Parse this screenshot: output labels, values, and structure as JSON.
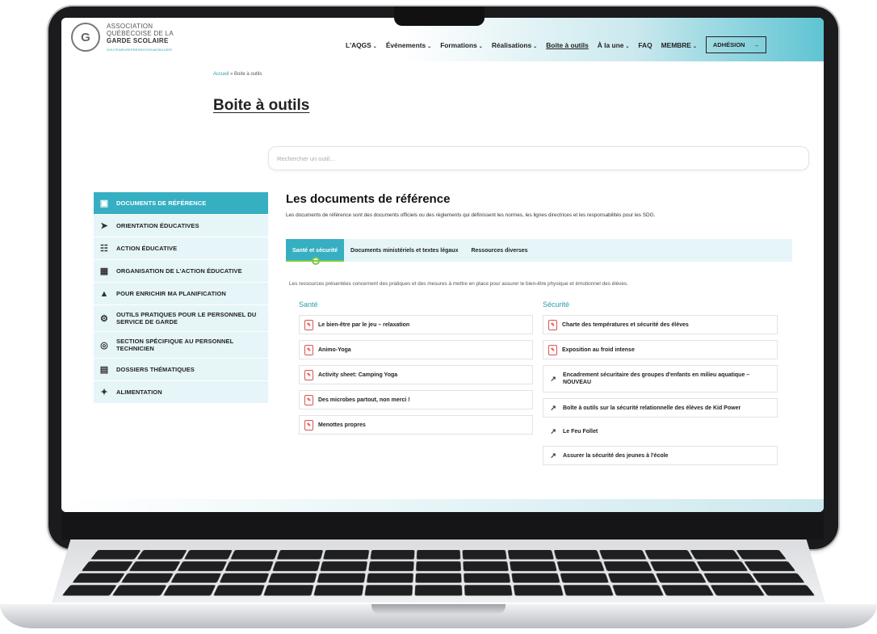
{
  "logo": {
    "line1": "ASSOCIATION",
    "line2": "QUÉBÉCOISE DE LA",
    "line3": "GARDE SCOLAIRE",
    "tagline": "SOUTENIR•REPRÉSENTER•MOBILISER"
  },
  "nav": {
    "items": [
      {
        "label": "L'AQGS",
        "caret": "⌄"
      },
      {
        "label": "Événements",
        "caret": "⌄"
      },
      {
        "label": "Formations",
        "caret": "⌄"
      },
      {
        "label": "Réalisations",
        "caret": "⌄"
      },
      {
        "label": "Boite à outils",
        "caret": ""
      },
      {
        "label": "À la une",
        "caret": "⌄"
      },
      {
        "label": "FAQ",
        "caret": ""
      },
      {
        "label": "MEMBRE",
        "caret": "⌄"
      }
    ],
    "adhesion": "ADHÉSION",
    "adhesion_arrow": "→"
  },
  "breadcrumb": {
    "home": "Accueil",
    "sep": " » ",
    "current": "Boite à outils"
  },
  "page_title": "Boite à outils",
  "search": {
    "placeholder": "Rechercher un outil..."
  },
  "sidebar": {
    "items": [
      {
        "label": "DOCUMENTS DE RÉFÉRENCE",
        "icon": "document-search-icon"
      },
      {
        "label": "ORIENTATION ÉDUCATIVES",
        "icon": "paper-plane-icon"
      },
      {
        "label": "ACTION ÉDUCATIVE",
        "icon": "magnifier-document-icon"
      },
      {
        "label": "ORGANISATION DE L'ACTION ÉDUCATIVE",
        "icon": "calendar-grid-icon"
      },
      {
        "label": "POUR ENRICHIR MA PLANIFICATION",
        "icon": "growth-chart-icon"
      },
      {
        "label": "OUTILS PRATIQUES POUR LE PERSONNEL DU SERVICE DE GARDE",
        "icon": "settings-people-icon"
      },
      {
        "label": "SECTION SPÉCIFIQUE AU PERSONNEL TECHNICIEN",
        "icon": "target-person-icon"
      },
      {
        "label": "DOSSIERS THÉMATIQUES",
        "icon": "folders-icon"
      },
      {
        "label": "ALIMENTATION",
        "icon": "carrot-icon"
      }
    ]
  },
  "main": {
    "heading": "Les documents de référence",
    "intro": "Les documents de référence sont des documents officiels ou des règlements qui définissent les normes, les lignes directrices et les responsabilités pour les SDG.",
    "tabs": [
      {
        "label": "Santé et sécurité"
      },
      {
        "label": "Documents ministériels et textes légaux"
      },
      {
        "label": "Ressources diverses"
      }
    ],
    "tab_description": "Les ressources présentées concernent des pratiques et des mesures à mettre en place pour assurer le bien-être physique et émotionnel des élèves.",
    "sante": {
      "title": "Santé",
      "docs": [
        "Le bien-être par le jeu – relaxation",
        "Animo-Yoga",
        "Activity sheet: Camping Yoga",
        "Des microbes partout, non merci !",
        "Menottes propres"
      ]
    },
    "securite": {
      "title": "Sécurité",
      "docs": [
        "Charte des températures et sécurité des élèves",
        "Exposition au froid intense",
        "Encadrement sécuritaire des groupes d'enfants en milieu aquatique – NOUVEAU",
        "Boîte à outils sur la sécurité relationnelle des élèves de Kid Power",
        "Le Feu Follet",
        "Assurer la sécurité des jeunes à l'école"
      ]
    }
  },
  "colors": {
    "accent": "#36afc2",
    "accent_light": "#e6f5f8",
    "link": "#2a9cae",
    "pdf": "#d9534f",
    "tab_indicator": "#7ac943"
  }
}
